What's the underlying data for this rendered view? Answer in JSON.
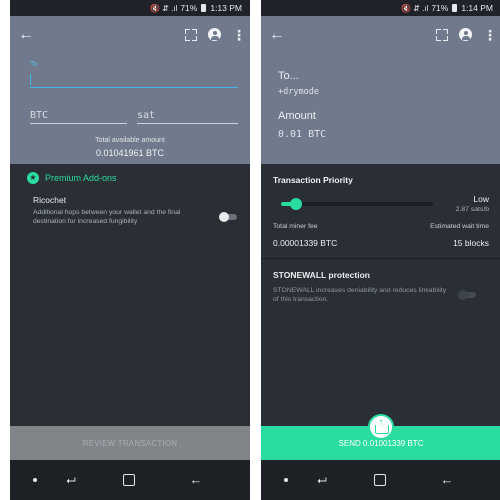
{
  "left_screen": {
    "status_bar": {
      "signal_icons": "🔇 ⇵ .ıl",
      "battery": "71%",
      "time": "1:13 PM"
    },
    "toolbar": {
      "back_icon": "arrow-left-icon",
      "scan_icon": "qr-scan-icon",
      "account_icon": "account-circle-icon",
      "menu_icon": "more-vert-icon"
    },
    "form": {
      "to_label": "To",
      "to_value": "",
      "btc_placeholder": "BTC",
      "sat_placeholder": "sat",
      "available_label": "Total available amount",
      "available_value": "0.01041961 BTC"
    },
    "addons": {
      "title": "Premium Add-ons",
      "ricochet_title": "Ricochet",
      "ricochet_desc": "Additional hops between your wallet and the final destination for increased fungibility",
      "ricochet_enabled": false
    },
    "review_button": "REVIEW TRANSACTION"
  },
  "right_screen": {
    "status_bar": {
      "signal_icons": "🔇 ⇵ .ıl",
      "battery": "71%",
      "time": "1:14 PM"
    },
    "summary": {
      "to_label": "To...",
      "to_value": "+drymode",
      "amount_label": "Amount",
      "amount_value": "0.01 BTC"
    },
    "priority": {
      "title": "Transaction Priority",
      "level": "Low",
      "rate": "2.87 sats/b",
      "slider_fraction": 0.1,
      "fee_label": "Total miner fee",
      "fee_value": "0.00001339 BTC",
      "wait_label": "Estimated wait time",
      "wait_value": "15 blocks"
    },
    "stonewall": {
      "title": "STONEWALL protection",
      "desc": "STONEWALL increases deniability and reduces linkability of this transaction.",
      "enabled": false
    },
    "send_button": "SEND 0.01001339 BTC"
  },
  "colors": {
    "accent": "#2bdca0",
    "toolbar": "#707a8c",
    "background": "#2a2f36",
    "input_focus": "#41b6e6"
  }
}
